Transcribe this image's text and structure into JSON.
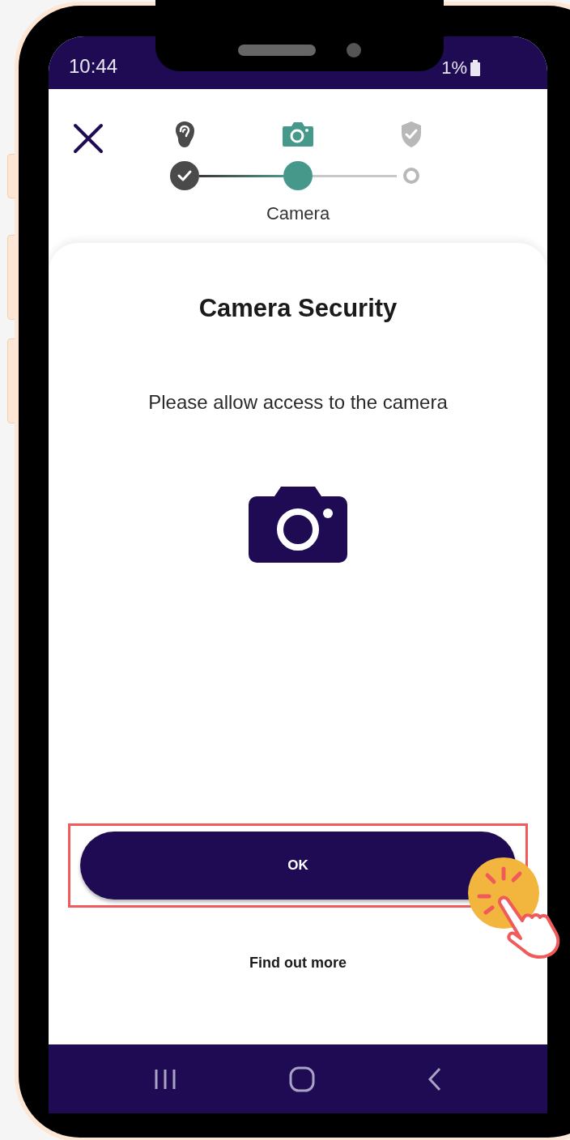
{
  "status_bar": {
    "time": "10:44",
    "battery": "1%"
  },
  "stepper": {
    "steps": [
      {
        "completed": true,
        "selected": false
      },
      {
        "completed": false,
        "selected": true
      },
      {
        "completed": false,
        "selected": false
      }
    ],
    "current_label": "Camera"
  },
  "card": {
    "title": "Camera Security",
    "message": "Please allow access to the camera"
  },
  "ok_button": {
    "label": "OK",
    "highlighted": true
  },
  "link": "Find out more"
}
